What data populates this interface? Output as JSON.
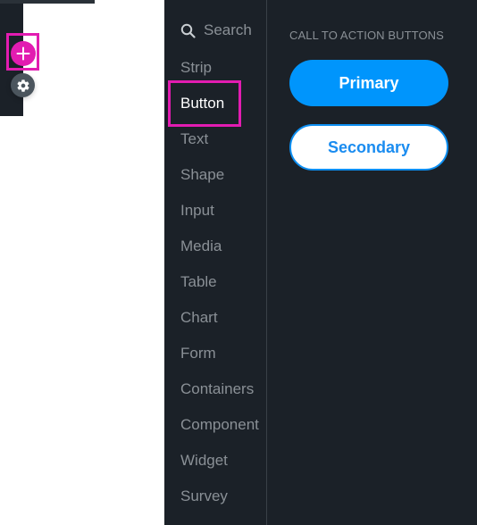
{
  "canvas": {
    "add_button_icon": "plus-icon",
    "settings_button_icon": "gear-icon"
  },
  "sidebar": {
    "search_placeholder": "Search",
    "items": [
      {
        "label": "Strip",
        "active": false
      },
      {
        "label": "Button",
        "active": true
      },
      {
        "label": "Text",
        "active": false
      },
      {
        "label": "Shape",
        "active": false
      },
      {
        "label": "Input",
        "active": false
      },
      {
        "label": "Media",
        "active": false
      },
      {
        "label": "Table",
        "active": false
      },
      {
        "label": "Chart",
        "active": false
      },
      {
        "label": "Form",
        "active": false
      },
      {
        "label": "Containers",
        "active": false
      },
      {
        "label": "Component",
        "active": false
      },
      {
        "label": "Widget",
        "active": false
      },
      {
        "label": "Survey",
        "active": false
      }
    ]
  },
  "content": {
    "section_title": "CALL TO ACTION BUTTONS",
    "primary_label": "Primary",
    "secondary_label": "Secondary"
  },
  "colors": {
    "accent_highlight": "#e21cb1",
    "primary_blue": "#0095fc",
    "panel_bg": "#1b2128"
  }
}
